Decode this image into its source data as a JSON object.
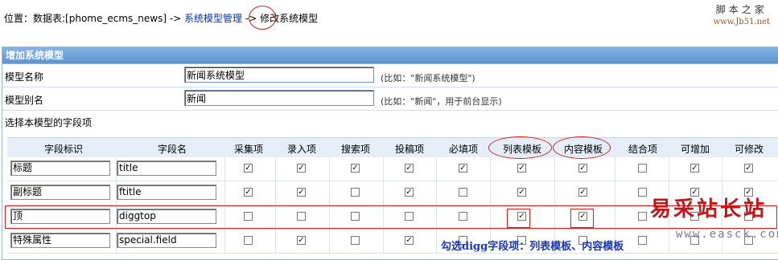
{
  "breadcrumb": {
    "prefix": "位置：数据表:[phome_ecms_news] -> ",
    "link1": "系统模型管理",
    "sep": " -> ",
    "current_a": "修改",
    "current_b": "系统模型"
  },
  "watermark_top": {
    "line1": "脚本之家",
    "line2": "www.Jb51.net"
  },
  "panel": {
    "title": "增加系统模型"
  },
  "form": {
    "model_name": {
      "label": "模型名称",
      "value": "新闻系统模型",
      "hint": "(比如：\"新闻系统模型\")"
    },
    "model_alias": {
      "label": "模型别名",
      "value": "新闻",
      "hint": "(比如：\"新闻\"，用于前台显示)"
    },
    "select_fields_label": "选择本模型的字段项"
  },
  "table": {
    "headers": [
      "字段标识",
      "字段名",
      "采集项",
      "录入项",
      "搜索项",
      "投稿项",
      "必填项",
      "列表模板",
      "内容模板",
      "结合项",
      "可增加",
      "可修改"
    ],
    "rows": [
      {
        "id": "标题",
        "name": "title",
        "checks": [
          true,
          true,
          true,
          true,
          true,
          true,
          true,
          false,
          true,
          true
        ]
      },
      {
        "id": "副标题",
        "name": "ftitle",
        "checks": [
          true,
          true,
          false,
          true,
          false,
          true,
          true,
          false,
          true,
          true
        ]
      },
      {
        "id": "顶",
        "name": "diggtop",
        "checks": [
          false,
          false,
          false,
          false,
          false,
          true,
          true,
          false,
          false,
          false
        ]
      },
      {
        "id": "特殊属性",
        "name": "special.field",
        "checks": [
          false,
          true,
          false,
          true,
          false,
          false,
          false,
          false,
          false,
          false
        ]
      }
    ]
  },
  "overlay": {
    "brand": "易采站长站",
    "brand_url": "www.easck.com",
    "note": "勾选digg字段项：列表模板、内容模板"
  },
  "colors": {
    "annotation_red": "#d82020",
    "header_blue": "#5e93cf",
    "link_blue": "#0033aa"
  }
}
